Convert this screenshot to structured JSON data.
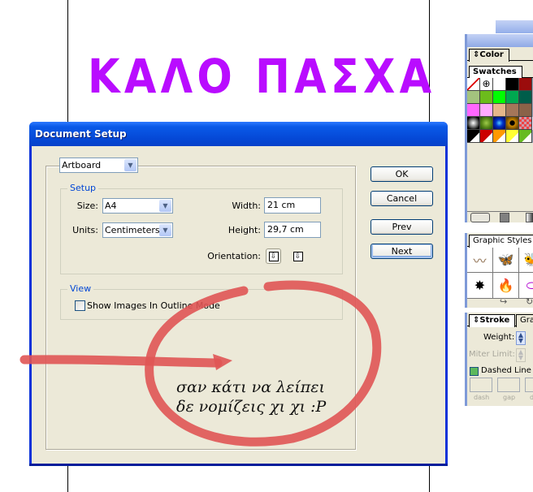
{
  "canvas": {
    "heading_text": "ΚΑΛΟ ΠΑΣΧΑ",
    "heading_color": "#b90cff"
  },
  "panels": {
    "color_tab": "Color",
    "swatches_tab": "Swatches",
    "graphic_styles_tab": "Graphic Styles",
    "stroke_tab": "Stroke",
    "gradient_tab_partial": "Gra",
    "swatches": [
      [
        "none",
        "registration",
        "#ffffff",
        "#000000",
        "#9b0c0c"
      ],
      [
        "#a3c37e",
        "#6cbc1c",
        "#00ff00",
        "#00a850",
        "#005d4a"
      ],
      [
        "#ff66ff",
        "#ffaaff",
        "#e5b68a",
        "#a5765a",
        "#8a6248"
      ],
      [
        "radial-gray",
        "radial-green",
        "radial-blue",
        "radial-orange",
        "pattern"
      ],
      [
        "#000000",
        "#cc0000",
        "#ff9900",
        "#ffff33",
        "#66bb22"
      ]
    ],
    "graphic_styles": [
      "rope-style",
      "butterfly-style",
      "bee-style",
      "sparkle-style",
      "fire-style",
      "purple-ring-style"
    ],
    "stroke": {
      "weight_label": "Weight:",
      "miter_label": "Miter Limit:",
      "dashed_line_label": "Dashed Line",
      "dashed_checked": true,
      "dash_labels": [
        "dash",
        "gap",
        "d"
      ]
    }
  },
  "dialog": {
    "title": "Document Setup",
    "section_select": "Artboard",
    "setup": {
      "title": "Setup",
      "size_label": "Size:",
      "size_value": "A4",
      "units_label": "Units:",
      "units_value": "Centimeters",
      "width_label": "Width:",
      "width_value": "21 cm",
      "height_label": "Height:",
      "height_value": "29,7 cm",
      "orientation_label": "Orientation:",
      "orientation_selected": "portrait"
    },
    "view": {
      "title": "View",
      "show_images_label": "Show Images In Outline Mode",
      "show_images_checked": false
    },
    "buttons": {
      "ok": "OK",
      "cancel": "Cancel",
      "prev": "Prev",
      "next": "Next"
    }
  },
  "annotation": {
    "line1": "σαν κάτι να λείπει",
    "line2": "δε νομίζεις χι χι :P",
    "color": "#e05555"
  }
}
